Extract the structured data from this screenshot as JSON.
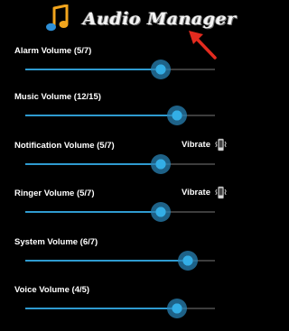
{
  "header": {
    "title": "Audio Manager",
    "logo_icon": "music-note-icon",
    "annotation_icon": "red-arrow-icon"
  },
  "accent_color": "#33b5e5",
  "vibrate_label": "Vibrate",
  "volumes": [
    {
      "label": "Alarm Volume (5/7)",
      "level": 5,
      "max": 7,
      "vibrate": false
    },
    {
      "label": "Music Volume (12/15)",
      "level": 12,
      "max": 15,
      "vibrate": false
    },
    {
      "label": "Notification Volume (5/7)",
      "level": 5,
      "max": 7,
      "vibrate": true
    },
    {
      "label": "Ringer Volume (5/7)",
      "level": 5,
      "max": 7,
      "vibrate": true
    },
    {
      "label": "System Volume (6/7)",
      "level": 6,
      "max": 7,
      "vibrate": false
    },
    {
      "label": "Voice Volume (4/5)",
      "level": 4,
      "max": 5,
      "vibrate": false
    }
  ]
}
